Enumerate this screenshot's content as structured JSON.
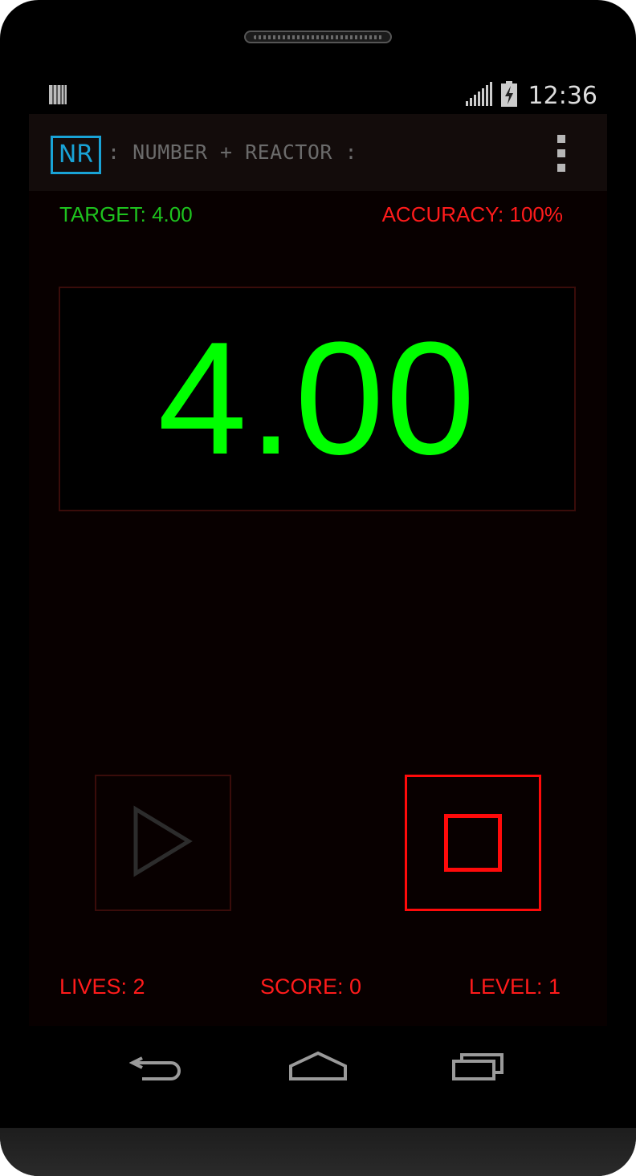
{
  "status_bar": {
    "time": "12:36",
    "icons": [
      "notification-icon",
      "signal-icon",
      "battery-charging-icon"
    ]
  },
  "action_bar": {
    "logo_text": "NR",
    "title": ": NUMBER + REACTOR :",
    "menu_icon": "overflow-menu-icon"
  },
  "game": {
    "target": "TARGET: 4.00",
    "accuracy": "ACCURACY: 100%",
    "display_value": "4.00",
    "play_icon": "play-icon",
    "stop_icon": "stop-icon",
    "lives": "LIVES: 2",
    "score": "SCORE: 0",
    "level": "LEVEL: 1"
  },
  "nav_bar": {
    "icons": [
      "back-icon",
      "home-icon",
      "recent-apps-icon"
    ]
  },
  "colors": {
    "display_green": "#00ff00",
    "target_green": "#1ec21e",
    "alert_red": "#ff1b1b",
    "logo_blue": "#19a3d6",
    "screen_bg": "#080000"
  }
}
